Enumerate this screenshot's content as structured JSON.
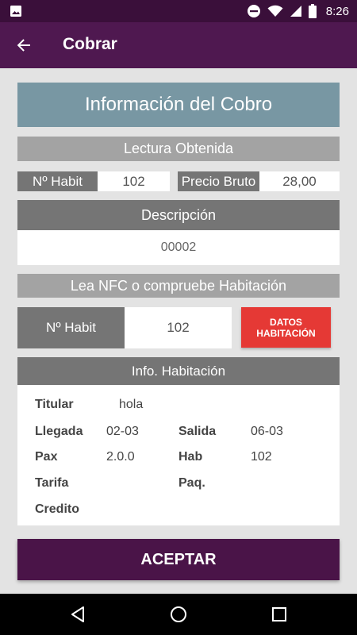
{
  "status_bar": {
    "time": "8:26",
    "icons": [
      "image-icon",
      "do-not-disturb-icon",
      "wifi-icon",
      "signal-icon",
      "battery-icon"
    ]
  },
  "app_bar": {
    "title": "Cobrar",
    "back_icon": "arrow-back-icon"
  },
  "card": {
    "title": "Información del Cobro",
    "lectura_header": "Lectura Obtenida",
    "habit_label": "Nº Habit",
    "habit_value": "102",
    "precio_label": "Precio Bruto",
    "precio_value": "28,00",
    "descripcion_header": "Descripción",
    "descripcion_value": "00002",
    "nfc_header": "Lea NFC o compruebe Habitación",
    "nfc_habit_label": "Nº Habit",
    "nfc_habit_value": "102",
    "datos_button_line1": "DATOS",
    "datos_button_line2": "HABITACIÓN"
  },
  "info": {
    "header": "Info. Habitación",
    "titular_label": "Titular",
    "titular_value": "hola",
    "llegada_label": "Llegada",
    "llegada_value": "02-03",
    "salida_label": "Salida",
    "salida_value": "06-03",
    "pax_label": "Pax",
    "pax_value": "2.0.0",
    "hab_label": "Hab",
    "hab_value": "102",
    "tarifa_label": "Tarifa",
    "paq_label": "Paq.",
    "credito_label": "Credito"
  },
  "actions": {
    "aceptar_label": "ACEPTAR"
  },
  "colors": {
    "status_bar": "#3a0f3a",
    "app_bar": "#4f1850",
    "title_card": "#7897a3",
    "band_light": "#a3a3a3",
    "band_dark": "#757575",
    "datos_button": "#e53935",
    "aceptar_button": "#4a1448"
  },
  "nav_bar": {
    "icons": [
      "back-triangle-icon",
      "home-circle-icon",
      "recents-square-icon"
    ]
  }
}
